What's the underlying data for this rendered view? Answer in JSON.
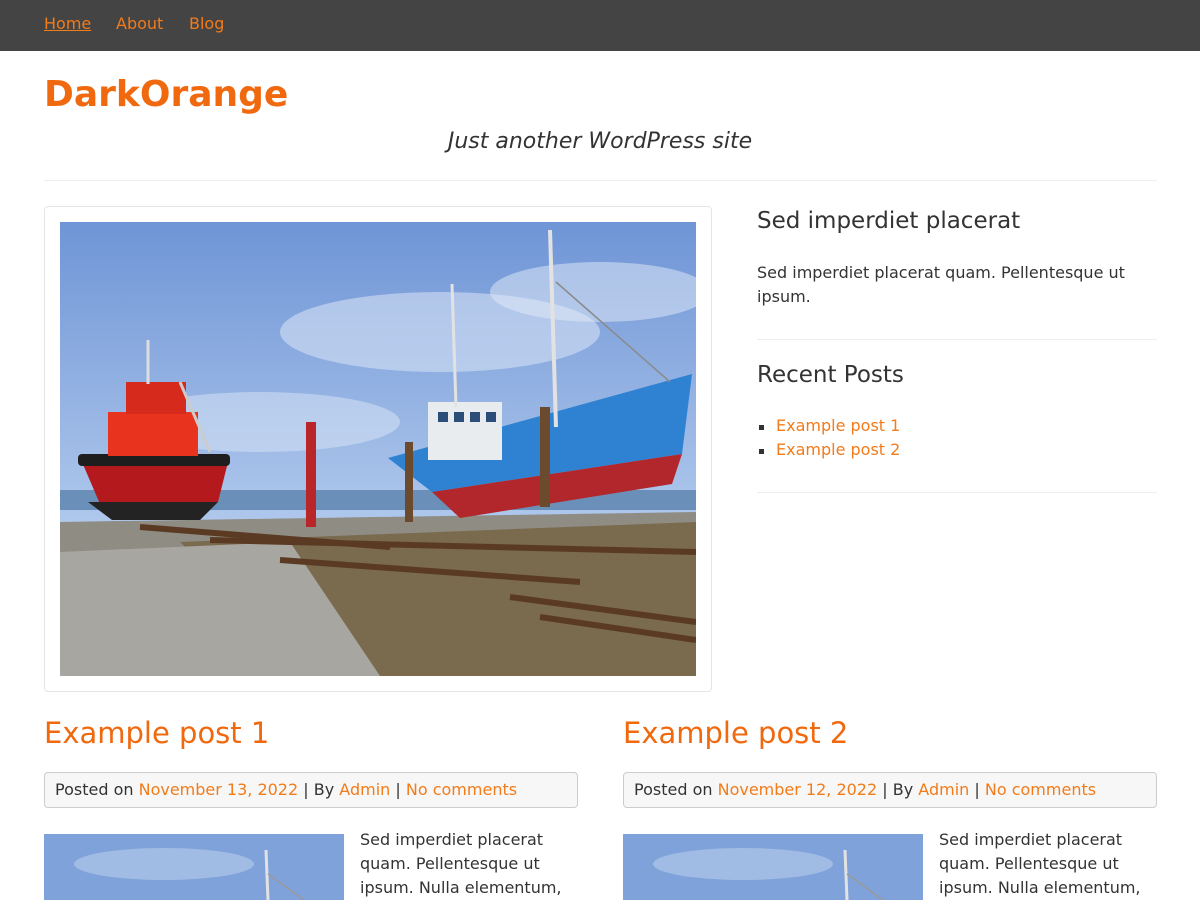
{
  "colors": {
    "nav_bg": "#444444",
    "accent": "#f0690f",
    "link": "#f27b1a",
    "text": "#333333"
  },
  "nav": {
    "items": [
      "Home",
      "About",
      "Blog"
    ],
    "current": "Home"
  },
  "site": {
    "title": "DarkOrange",
    "tagline": "Just another WordPress site"
  },
  "featured_image": {
    "description_icon": "boats-in-dry-dock-photo"
  },
  "sidebar": {
    "text_widget": {
      "title": "Sed imperdiet placerat",
      "text": "Sed imperdiet placerat quam. Pellentesque ut ipsum."
    },
    "recent_posts": {
      "title": "Recent Posts",
      "items": [
        "Example post 1",
        "Example post 2"
      ]
    }
  },
  "posts": [
    {
      "title": "Example post 1",
      "posted_on_label": "Posted on",
      "date": "November 13, 2022",
      "by_label": "By",
      "author": "Admin",
      "comments": "No comments",
      "separator": "|",
      "excerpt": "Sed imperdiet placerat quam. Pellentesque ut ipsum. Nulla elementum,"
    },
    {
      "title": "Example post 2",
      "posted_on_label": "Posted on",
      "date": "November 12, 2022",
      "by_label": "By",
      "author": "Admin",
      "comments": "No comments",
      "separator": "|",
      "excerpt": "Sed imperdiet placerat quam. Pellentesque ut ipsum. Nulla elementum,"
    }
  ]
}
